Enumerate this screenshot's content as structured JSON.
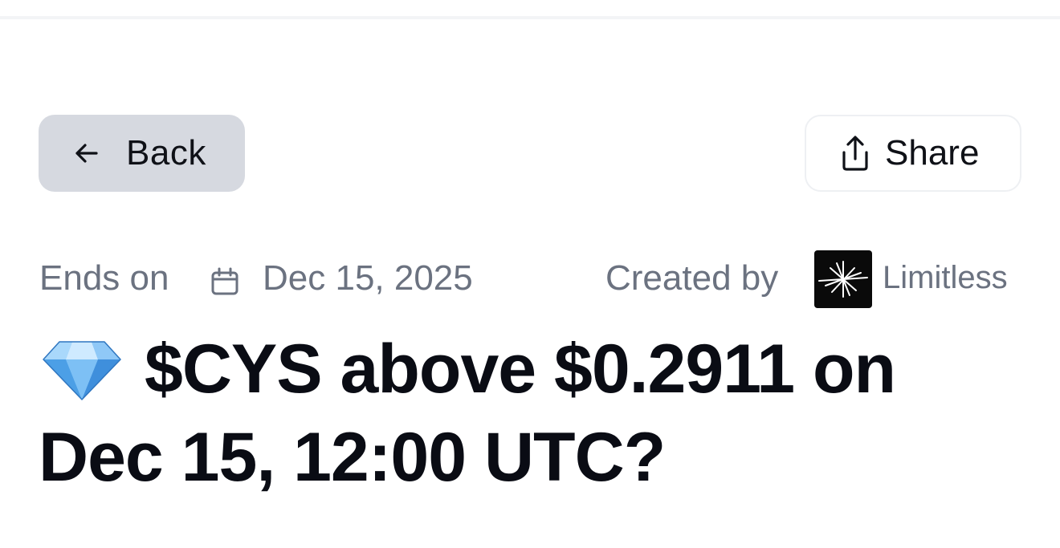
{
  "header": {
    "back_label": "Back",
    "share_label": "Share"
  },
  "meta": {
    "ends_label": "Ends on",
    "ends_date": "Dec 15, 2025",
    "created_label": "Created by",
    "creator_name": "Limitless"
  },
  "title": {
    "line1": "$CYS above $0.2911 on",
    "line2": "Dec 15, 12:00 UTC?"
  },
  "icons": {
    "back": "arrow-left-icon",
    "share": "share-icon",
    "calendar": "calendar-icon",
    "creator": "limitless-logo",
    "title": "diamond-icon"
  },
  "colors": {
    "back_bg": "#d6d9e0",
    "muted_text": "#6b7280",
    "title_text": "#0a0c14"
  }
}
